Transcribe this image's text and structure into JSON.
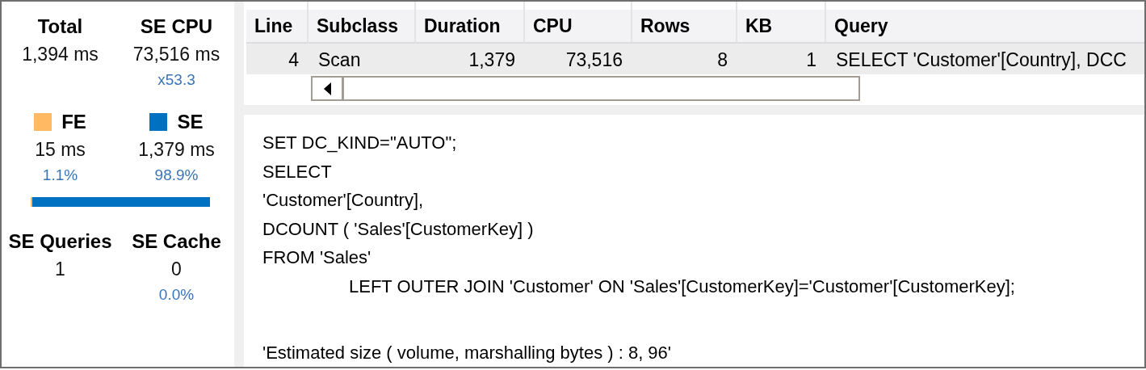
{
  "summary": {
    "totals": [
      {
        "label": "Total",
        "value": "1,394 ms"
      },
      {
        "label": "SE CPU",
        "value": "73,516 ms",
        "sub": "x53.3"
      }
    ],
    "engines": [
      {
        "label": "FE",
        "color": "#ffb963",
        "value": "15 ms",
        "sub": "1.1%",
        "level": 0.011
      },
      {
        "label": "SE",
        "color": "#0070c0",
        "value": "1,379 ms",
        "sub": "98.9%"
      }
    ],
    "counts": [
      {
        "label": "SE Queries",
        "value": "1"
      },
      {
        "label": "SE Cache",
        "value": "0",
        "sub": "0.0%"
      }
    ]
  },
  "table": {
    "columns": [
      {
        "label": "Line",
        "kind": "number"
      },
      {
        "label": "Subclass",
        "kind": "text"
      },
      {
        "label": "Duration",
        "kind": "number"
      },
      {
        "label": "CPU",
        "kind": "number"
      },
      {
        "label": "Rows",
        "kind": "number"
      },
      {
        "label": "KB",
        "kind": "number"
      },
      {
        "label": "Query",
        "kind": "text"
      }
    ],
    "rows": [
      {
        "selected": true,
        "cells": [
          "4",
          "Scan",
          "1,379",
          "73,516",
          "8",
          "1",
          "SELECT 'Customer'[Country], DCC"
        ]
      }
    ]
  },
  "query_text": [
    {
      "kind": "plain",
      "text": "SET DC_KIND=\"AUTO\";"
    },
    {
      "kind": "plain",
      "text": "SELECT"
    },
    {
      "kind": "plain",
      "text": "'Customer'[Country],"
    },
    {
      "kind": "plain",
      "text": "DCOUNT ( 'Sales'[CustomerKey] )"
    },
    {
      "kind": "plain",
      "text": "FROM 'Sales'"
    },
    {
      "kind": "indented",
      "text": "LEFT OUTER JOIN 'Customer' ON 'Sales'[CustomerKey]='Customer'[CustomerKey];"
    },
    {
      "kind": "detached",
      "text": "'Estimated size ( volume, marshalling bytes ) : 8, 96'"
    }
  ]
}
